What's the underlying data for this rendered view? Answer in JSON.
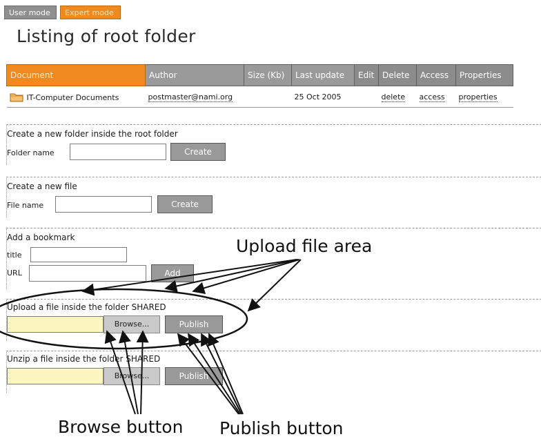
{
  "modes": {
    "user": "User mode",
    "expert": "Expert mode"
  },
  "page_title": "Listing of root folder",
  "table": {
    "headers": [
      "Document",
      "Author",
      "Size (Kb)",
      "Last update",
      "Edit",
      "Delete",
      "Access",
      "Properties"
    ],
    "row": {
      "document": "IT-Computer Documents",
      "author": "postmaster@nami.org",
      "size": "",
      "last_update": "25 Oct 2005",
      "edit": "",
      "delete": "delete",
      "access": "access",
      "properties": "properties"
    }
  },
  "create_folder": {
    "title": "Create a new folder inside the root folder",
    "label": "Folder name",
    "button": "Create"
  },
  "create_file": {
    "title": "Create a new file",
    "label": "File name",
    "button": "Create"
  },
  "bookmark": {
    "title": "Add a bookmark",
    "title_label": "title",
    "url_label": "URL",
    "button": "Add"
  },
  "upload": {
    "title": "Upload a file inside the folder SHARED",
    "browse": "Browse...",
    "button": "Publish"
  },
  "unzip": {
    "title": "Unzip a file inside the folder SHARED",
    "browse": "Browse...",
    "button": "Publish"
  },
  "annotations": {
    "upload_area": "Upload file area",
    "browse_button": "Browse button",
    "publish_button": "Publish button"
  },
  "colors": {
    "expert_orange": "#f08a1e",
    "header_gray": "#8c8c8c",
    "file_input_yellow": "#fbf6c0"
  }
}
